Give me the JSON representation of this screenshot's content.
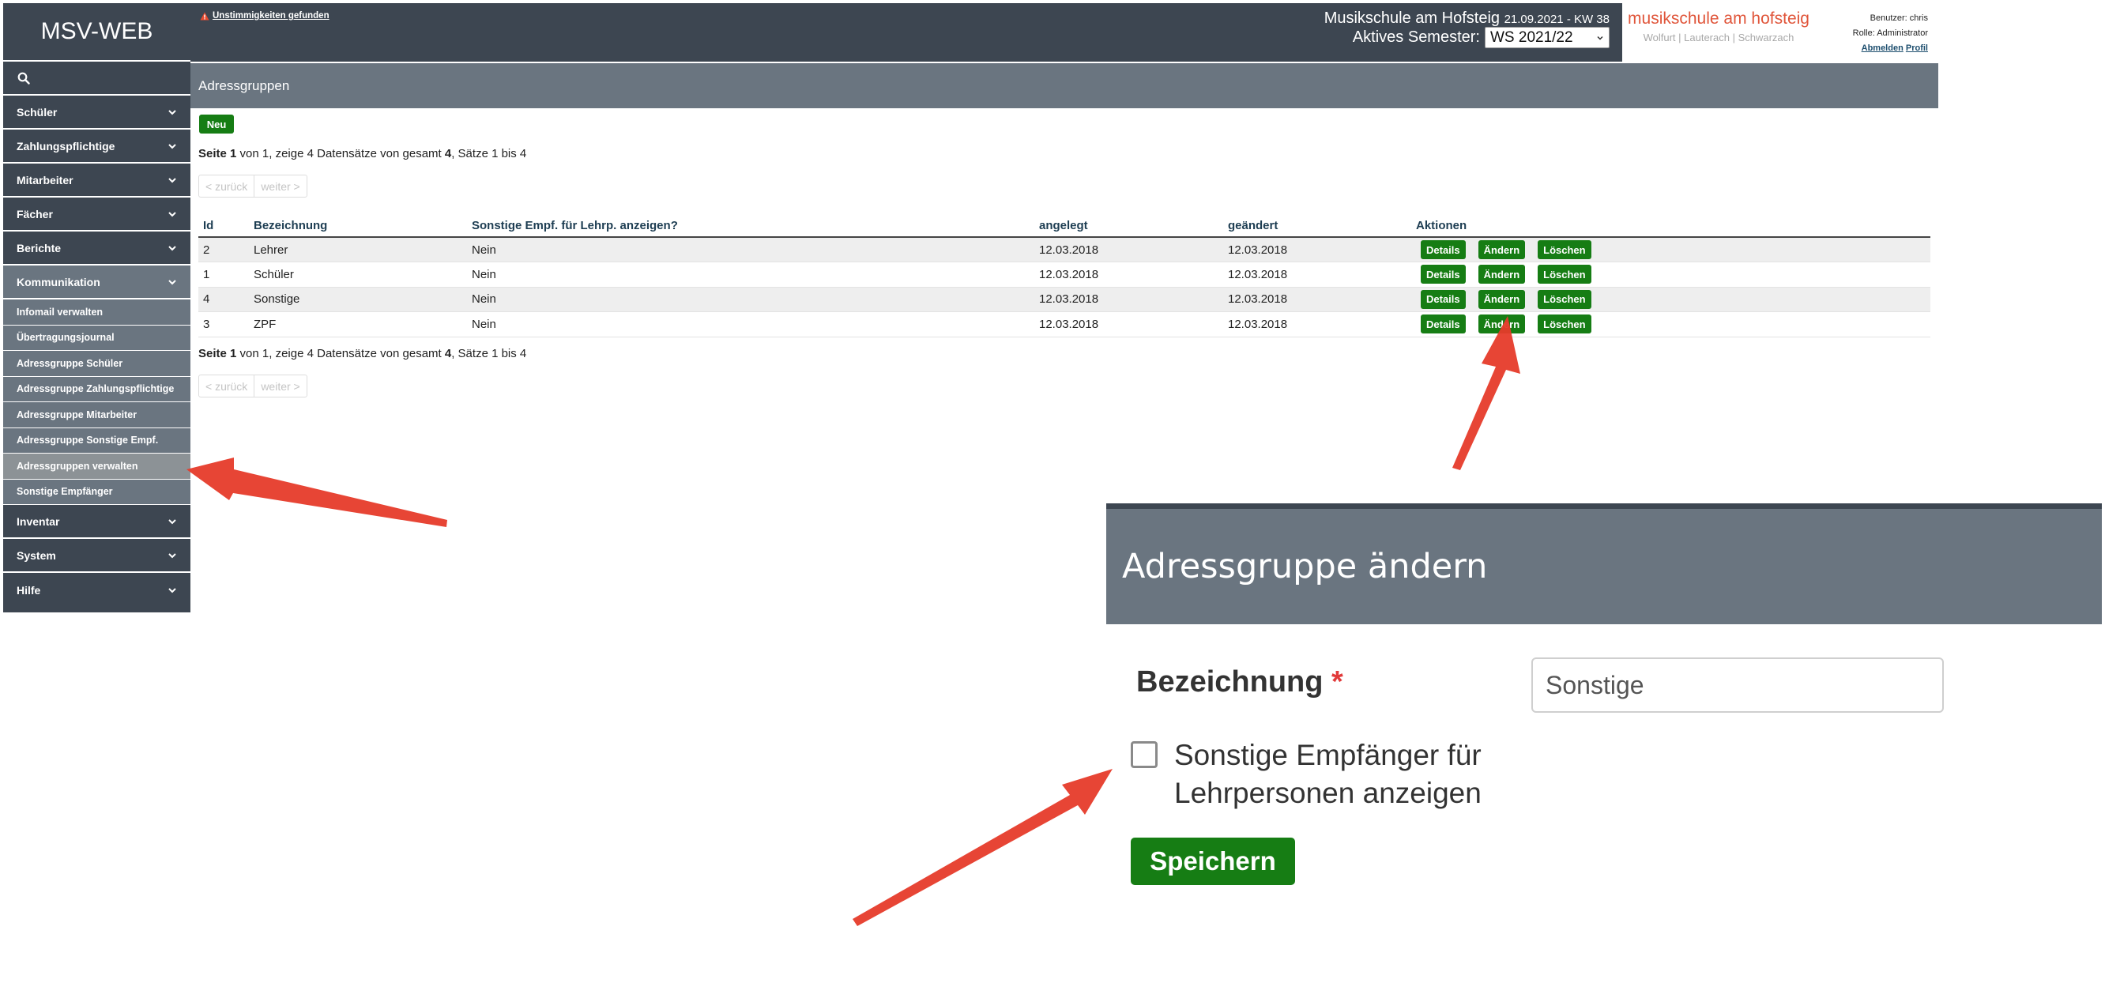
{
  "app": {
    "brand": "MSV-WEB"
  },
  "header": {
    "warning": "Unstimmigkeiten gefunden",
    "school": "Musikschule am Hofsteig",
    "date_week": "21.09.2021 - KW 38",
    "semester_label": "Aktives Semester:",
    "semester_value": "WS 2021/22"
  },
  "logo": {
    "main": "musikschule am hofsteig",
    "sub": "Wolfurt | Lauterach | Schwarzach"
  },
  "user": {
    "user": "Benutzer: chris",
    "role": "Rolle: Administrator",
    "logout": "Abmelden",
    "profile": "Profil"
  },
  "sidebar": {
    "main_items": [
      "Schüler",
      "Zahlungspflichtige",
      "Mitarbeiter",
      "Fächer",
      "Berichte",
      "Kommunikation"
    ],
    "sub_items": [
      "Infomail verwalten",
      "Übertragungsjournal",
      "Adressgruppe Schüler",
      "Adressgruppe Zahlungspflichtige",
      "Adressgruppe Mitarbeiter",
      "Adressgruppe Sonstige Empf.",
      "Adressgruppen verwalten",
      "Sonstige Empfänger"
    ],
    "bottom_items": [
      "Inventar",
      "System",
      "Hilfe"
    ]
  },
  "page": {
    "title": "Adressgruppen",
    "new_label": "Neu",
    "page_info_bold": "Seite 1",
    "page_info_mid": " von 1, zeige 4 Datensätze von gesamt ",
    "page_info_total": "4",
    "page_info_tail": ", Sätze 1 bis 4",
    "prev_label": "< zurück",
    "next_label": "weiter >"
  },
  "table": {
    "columns": [
      "Id",
      "Bezeichnung",
      "Sonstige Empf. für Lehrp. anzeigen?",
      "angelegt",
      "geändert",
      "Aktionen"
    ],
    "rows": [
      {
        "id": "2",
        "name": "Lehrer",
        "flag": "Nein",
        "created": "12.03.2018",
        "changed": "12.03.2018"
      },
      {
        "id": "1",
        "name": "Schüler",
        "flag": "Nein",
        "created": "12.03.2018",
        "changed": "12.03.2018"
      },
      {
        "id": "4",
        "name": "Sonstige",
        "flag": "Nein",
        "created": "12.03.2018",
        "changed": "12.03.2018"
      },
      {
        "id": "3",
        "name": "ZPF",
        "flag": "Nein",
        "created": "12.03.2018",
        "changed": "12.03.2018"
      }
    ],
    "action_details": "Details",
    "action_edit": "Ändern",
    "action_delete": "Löschen"
  },
  "zoom": {
    "title": "Adressgruppe ändern",
    "field_label": "Bezeichnung",
    "required_mark": "*",
    "field_value": "Sonstige",
    "checkbox_label": "Sonstige Empfänger für Lehrpersonen anzeigen",
    "save_label": "Speichern"
  },
  "colors": {
    "sidebar_dark": "#3d4651",
    "sidebar_sub": "#6a7580",
    "button_green": "#167d14",
    "logo_accent": "#e0553a",
    "arrow_red": "#e63b2a"
  }
}
